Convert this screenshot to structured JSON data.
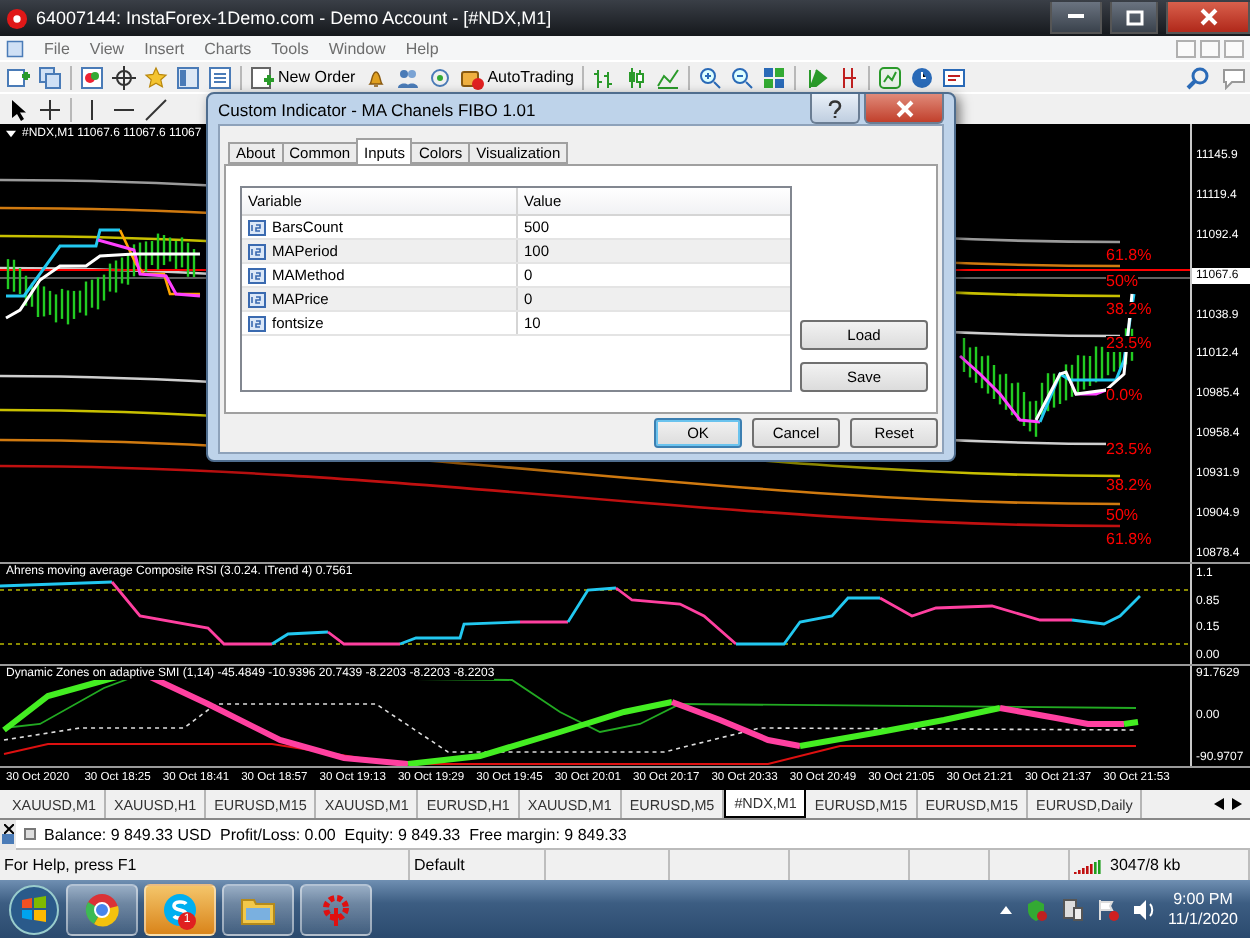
{
  "window": {
    "title": "64007144: InstaForex-1Demo.com - Demo Account - [#NDX,M1]"
  },
  "menu": [
    "File",
    "View",
    "Insert",
    "Charts",
    "Tools",
    "Window",
    "Help"
  ],
  "toolbar": {
    "buttons": [
      "New Order",
      "AutoTrading"
    ]
  },
  "chart": {
    "header": "#NDX,M1 11067.6 11067.6 11067",
    "price_axis": [
      {
        "label": "11145.9",
        "current": false
      },
      {
        "label": "11119.4",
        "current": false
      },
      {
        "label": "11092.4",
        "current": false
      },
      {
        "label": "11067.6",
        "current": true
      },
      {
        "label": "11038.9",
        "current": false
      },
      {
        "label": "11012.4",
        "current": false
      },
      {
        "label": "10985.4",
        "current": false
      },
      {
        "label": "10958.4",
        "current": false
      },
      {
        "label": "10931.9",
        "current": false
      },
      {
        "label": "10904.9",
        "current": false
      },
      {
        "label": "10878.4",
        "current": false
      }
    ],
    "fibo_levels": [
      "61.8%",
      "50%",
      "38.2%",
      "23.5%",
      "0.0%",
      "23.5%",
      "38.2%",
      "50%",
      "61.8%"
    ],
    "indicators": [
      {
        "title": "Ahrens moving average Composite RSI (3.0.24. ITrend 4) 0.7561",
        "axis": [
          "1.1",
          "0.85",
          "0.15",
          "0.00"
        ]
      },
      {
        "title": "Dynamic Zones on adaptive SMI (1,14) -45.4849 -10.9396 20.7439 -8.2203 -8.2203 -8.2203",
        "axis": [
          "91.7629",
          "0.00",
          "-90.9707"
        ]
      }
    ],
    "time_axis": [
      "30 Oct 2020",
      "30 Oct 18:25",
      "30 Oct 18:41",
      "30 Oct 18:57",
      "30 Oct 19:13",
      "30 Oct 19:29",
      "30 Oct 19:45",
      "30 Oct 20:01",
      "30 Oct 20:17",
      "30 Oct 20:33",
      "30 Oct 20:49",
      "30 Oct 21:05",
      "30 Oct 21:21",
      "30 Oct 21:37",
      "30 Oct 21:53"
    ]
  },
  "chart_tabs": [
    {
      "label": "XAUUSD,M1",
      "selected": false
    },
    {
      "label": "XAUUSD,H1",
      "selected": false
    },
    {
      "label": "EURUSD,M15",
      "selected": false
    },
    {
      "label": "XAUUSD,M1",
      "selected": false
    },
    {
      "label": "EURUSD,H1",
      "selected": false
    },
    {
      "label": "XAUUSD,M1",
      "selected": false
    },
    {
      "label": "EURUSD,M5",
      "selected": false
    },
    {
      "label": "#NDX,M1",
      "selected": true
    },
    {
      "label": "EURUSD,M15",
      "selected": false
    },
    {
      "label": "EURUSD,M15",
      "selected": false
    },
    {
      "label": "EURUSD,Daily",
      "selected": false
    }
  ],
  "terminal": {
    "account": "Balance: 9 849.33 USD  Profit/Loss: 0.00  Equity: 9 849.33  Free margin: 9 849.33"
  },
  "status_bar": {
    "help": "For Help, press F1",
    "profile": "Default",
    "traffic": "3047/8 kb"
  },
  "taskbar": {
    "apps": [
      {
        "kind": "browser",
        "highlighted": false
      },
      {
        "kind": "messenger",
        "highlighted": true,
        "badge": "1"
      },
      {
        "kind": "folder",
        "highlighted": false
      },
      {
        "kind": "gear",
        "highlighted": false
      }
    ],
    "time": "9:00 PM",
    "date": "11/1/2020"
  },
  "dialog": {
    "title": "Custom Indicator - MA Chanels FIBO 1.01",
    "tabs": [
      {
        "label": "About",
        "selected": false
      },
      {
        "label": "Common",
        "selected": false
      },
      {
        "label": "Inputs",
        "selected": true
      },
      {
        "label": "Colors",
        "selected": false
      },
      {
        "label": "Visualization",
        "selected": false
      }
    ],
    "columns": [
      "Variable",
      "Value"
    ],
    "rows": [
      {
        "variable": "BarsCount",
        "value": "500"
      },
      {
        "variable": "MAPeriod",
        "value": "100"
      },
      {
        "variable": "MAMethod",
        "value": "0"
      },
      {
        "variable": "MAPrice",
        "value": "0"
      },
      {
        "variable": "fontsize",
        "value": "10"
      }
    ],
    "side_buttons": [
      "Load",
      "Save"
    ],
    "buttons": [
      {
        "label": "OK",
        "default": true
      },
      {
        "label": "Cancel",
        "default": false
      },
      {
        "label": "Reset",
        "default": false
      }
    ]
  }
}
